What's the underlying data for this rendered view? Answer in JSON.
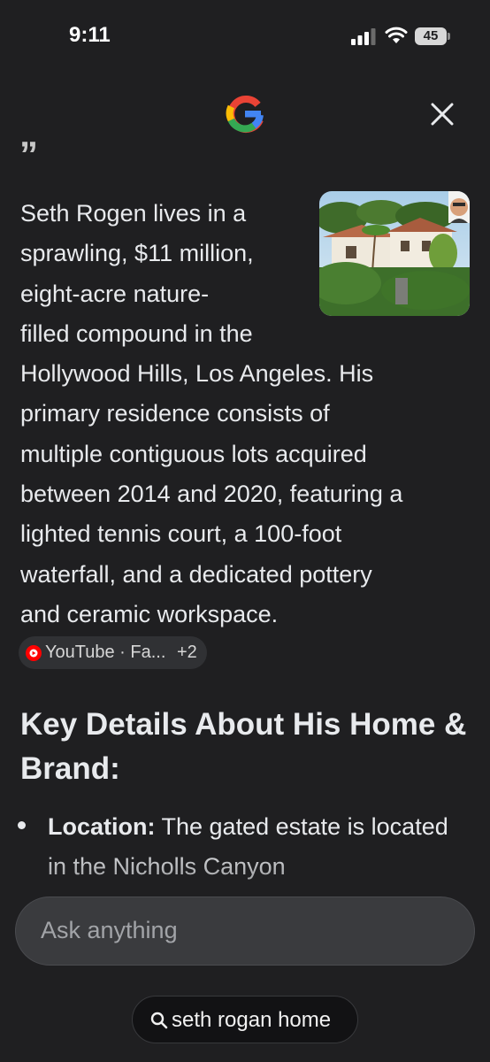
{
  "status_bar": {
    "time": "9:11",
    "battery_level": "45",
    "icons": [
      "cellular-signal-icon",
      "wifi-icon",
      "battery-icon"
    ]
  },
  "header": {
    "logo": "google-g-logo",
    "close_icon": "close-icon"
  },
  "answer": {
    "lines": [
      "Seth Rogen lives in a",
      "sprawling, $11 million,",
      "eight-acre nature-",
      "filled compound in the",
      "Hollywood Hills, Los Angeles. His",
      "primary residence consists of",
      "multiple contiguous lots acquired",
      "between 2014 and 2020, featuring a",
      "lighted tennis court, a 100-foot",
      "waterfall, and a dedicated pottery",
      "and ceramic workspace."
    ],
    "image": "house-photo"
  },
  "source_chip": {
    "icon": "youtube-icon",
    "label": "YouTube · Fa...",
    "more_count": "+2"
  },
  "section": {
    "heading": "Key Details About His Home & Brand:",
    "bullets": [
      {
        "label": "Location:",
        "text": "The gated estate is located in the Nicholls Canyon"
      }
    ]
  },
  "input": {
    "placeholder": "Ask anything"
  },
  "query_chip": {
    "icon": "search-icon",
    "text": "seth rogan home"
  },
  "colors": {
    "background": "#1f1f21",
    "text": "#e8eaed",
    "input_bg": "#3a3b3e",
    "youtube_red": "#ff0000"
  }
}
